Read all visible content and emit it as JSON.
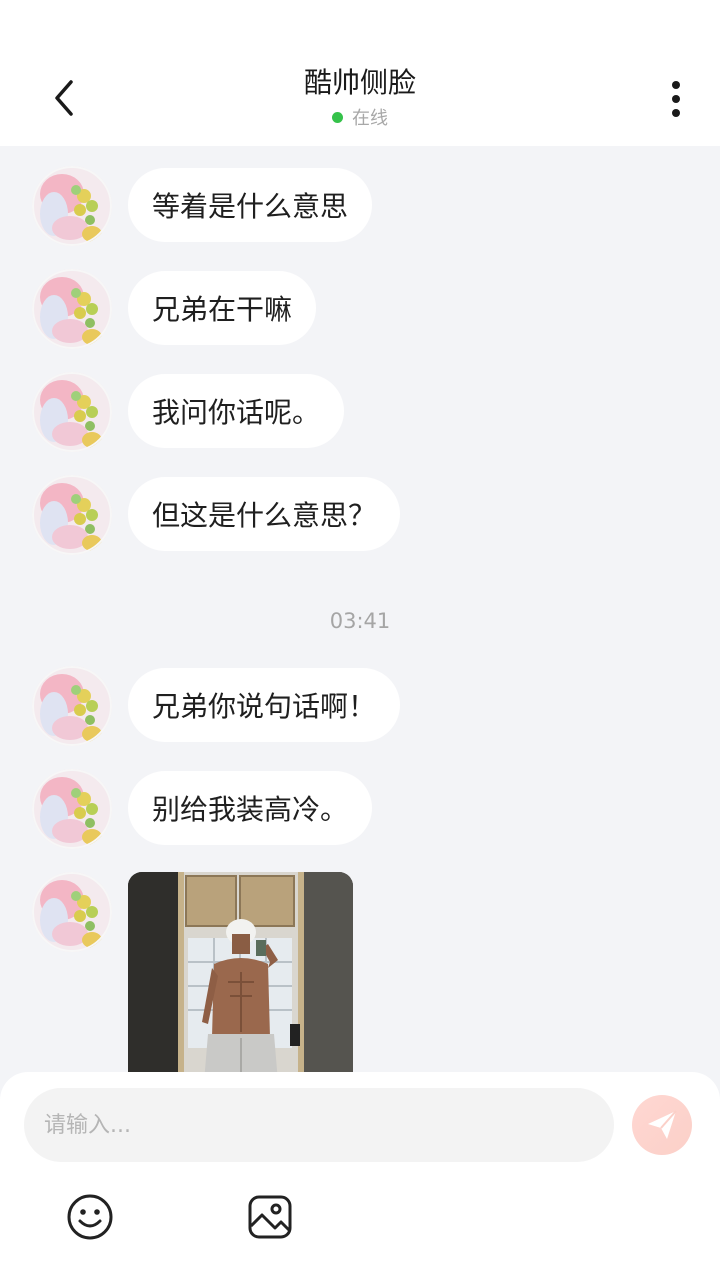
{
  "header": {
    "title": "酷帅侧脸",
    "status": "在线",
    "status_color": "#35c24a"
  },
  "messages_before": [
    {
      "text": "等着是什么意思"
    },
    {
      "text": "兄弟在干嘛"
    },
    {
      "text": "我问你话呢。"
    },
    {
      "text": "但这是什么意思？"
    }
  ],
  "timestamp": "03:41",
  "messages_after": [
    {
      "text": "兄弟你说句话啊！"
    },
    {
      "text": "别给我装高冷。"
    }
  ],
  "composer": {
    "placeholder": "请输入..."
  },
  "icons": {
    "back": "chevron-left-icon",
    "more": "more-vertical-icon",
    "send": "paper-plane-icon",
    "emoji": "smiley-icon",
    "image": "image-icon"
  }
}
